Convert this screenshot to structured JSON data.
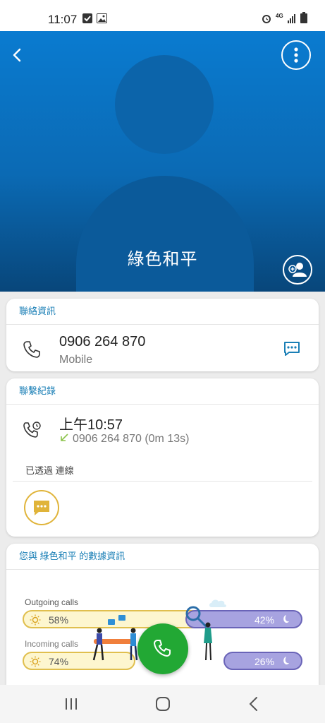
{
  "status_bar": {
    "time": "11:07",
    "network": "4G"
  },
  "contact": {
    "name": "綠色和平"
  },
  "contact_info": {
    "header": "聯絡資訊",
    "phone_number": "0906 264 870",
    "phone_type": "Mobile"
  },
  "call_log": {
    "header": "聯繫紀錄",
    "time": "上午10:57",
    "detail": "0906 264 870 (0m 13s)",
    "via": "已透過 連線"
  },
  "stats": {
    "header": "您與 綠色和平 的數據資訊",
    "outgoing": {
      "label": "Outgoing calls",
      "day_pct": "58%",
      "night_pct": "42%",
      "day_value": 58,
      "night_value": 42
    },
    "incoming": {
      "label": "Incoming calls",
      "day_pct": "74%",
      "night_pct": "26%",
      "day_value": 74,
      "night_value": 26
    }
  },
  "colors": {
    "accent": "#1a7fb6",
    "call_green": "#22a834",
    "hero_blue": "#0a7bd0",
    "message_yellow": "#e0b43a"
  },
  "icons": [
    "back-icon",
    "more-vert-icon",
    "add-contact-icon",
    "phone-icon",
    "message-icon",
    "call-history-icon",
    "chat-icon",
    "sun-icon",
    "moon-icon",
    "call-icon",
    "recents-icon",
    "home-icon",
    "back-nav-icon"
  ]
}
